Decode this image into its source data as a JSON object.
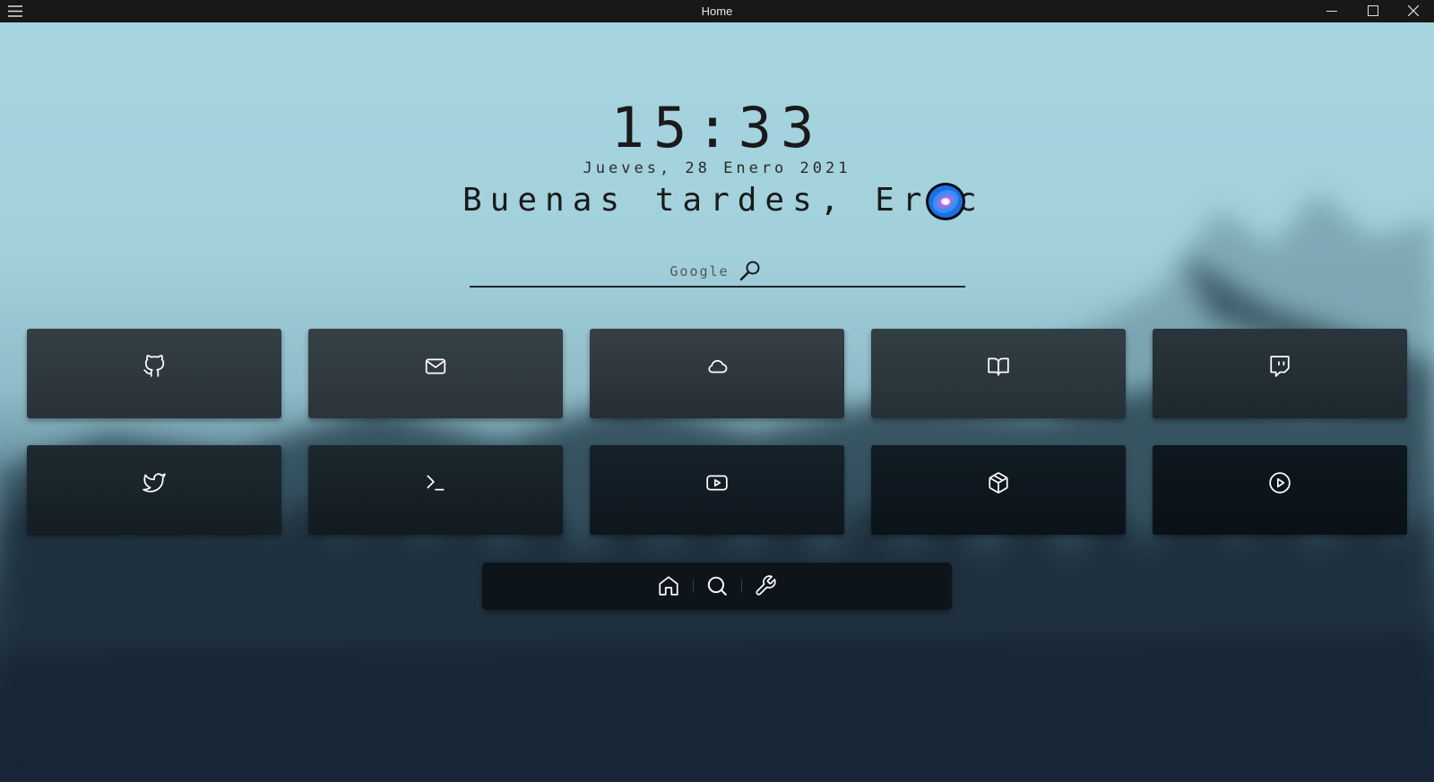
{
  "window": {
    "title": "Home",
    "controls": [
      "menu-icon",
      "minimize-icon",
      "maximize-icon",
      "close-icon"
    ]
  },
  "clock": {
    "time": "15:33",
    "date": "Jueves, 28 Enero 2021"
  },
  "greeting": {
    "text": "Buenas tardes, Eric",
    "avatar_icon": "galaxy-avatar-icon"
  },
  "search": {
    "placeholder": "Google",
    "icon": "magnifier-icon"
  },
  "tiles": [
    {
      "icon": "github-icon"
    },
    {
      "icon": "mail-icon"
    },
    {
      "icon": "cloud-icon"
    },
    {
      "icon": "book-icon"
    },
    {
      "icon": "twitch-icon"
    },
    {
      "icon": "twitter-icon"
    },
    {
      "icon": "terminal-icon"
    },
    {
      "icon": "youtube-icon"
    },
    {
      "icon": "package-icon"
    },
    {
      "icon": "play-circle-icon"
    }
  ],
  "dock": {
    "items": [
      "home-icon",
      "search-icon",
      "wrench-icon"
    ]
  },
  "colors": {
    "titlebar": "#181818",
    "sky": "#a7d5e0",
    "tile_top": "#2f3b41",
    "tile_bottom": "#0c1218",
    "dock": "#0d141a",
    "icon": "#ffffff"
  }
}
